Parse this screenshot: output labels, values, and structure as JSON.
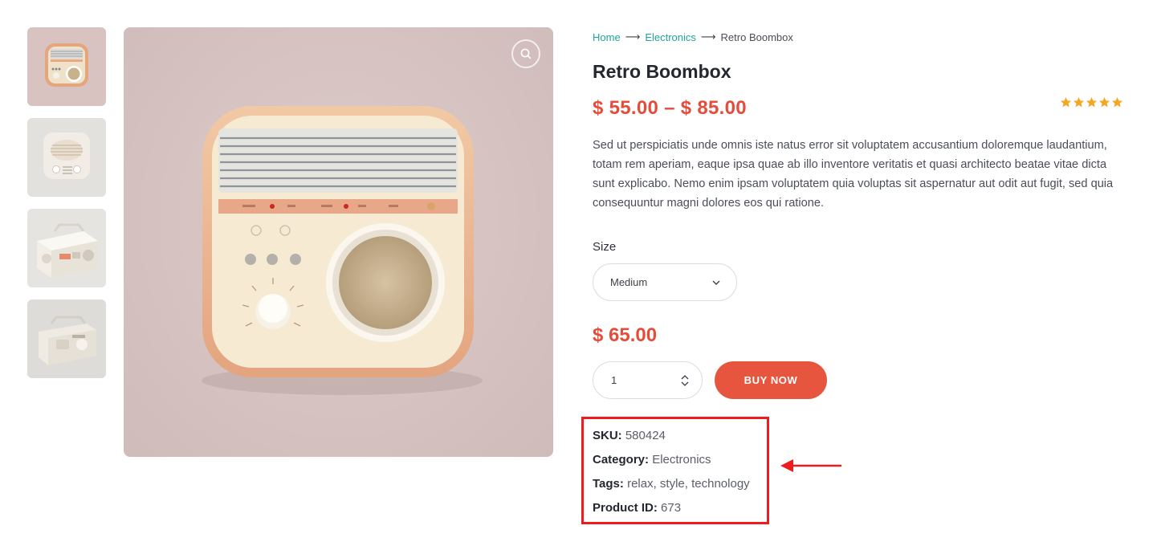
{
  "breadcrumb": {
    "home": "Home",
    "category": "Electronics",
    "separator": "⟶",
    "current": "Retro Boombox"
  },
  "product": {
    "title": "Retro Boombox",
    "price_range": "$ 55.00 – $ 85.00",
    "rating_stars": 5,
    "description": "Sed ut perspiciatis unde omnis iste natus error sit voluptatem accusantium doloremque laudantium, totam rem aperiam, eaque ipsa quae ab illo inventore veritatis et quasi architecto beatae vitae dicta sunt explicabo. Nemo enim ipsam voluptatem quia voluptas sit aspernatur aut odit aut fugit, sed quia consequuntur magni dolores eos qui ratione.",
    "size_label": "Size",
    "size_selected": "Medium",
    "price": "$ 65.00",
    "quantity": "1",
    "buy_label": "BUY NOW"
  },
  "meta": {
    "sku_label": "SKU:",
    "sku": "580424",
    "category_label": "Category:",
    "category": "Electronics",
    "tags_label": "Tags:",
    "tags": "relax, style, technology",
    "product_id_label": "Product ID:",
    "product_id": "673"
  },
  "icons": {
    "zoom": "search-icon",
    "select": "chevron-down-icon",
    "qty_up": "chevron-up-icon",
    "qty_down": "chevron-down-icon",
    "star": "star-icon"
  },
  "colors": {
    "accent": "#e54d3b",
    "button": "#e8553f",
    "link": "#1fa59c",
    "star": "#f5a623",
    "annotation": "#ee1c1c"
  }
}
